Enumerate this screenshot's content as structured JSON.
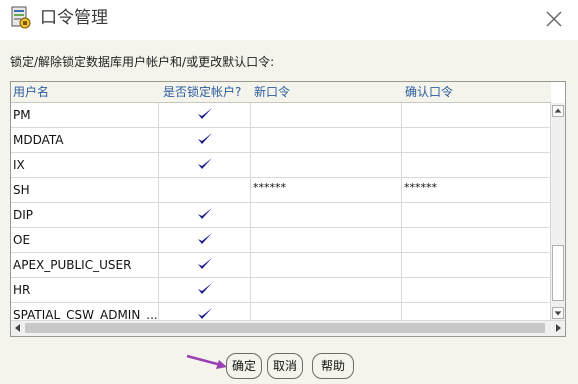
{
  "window": {
    "title": "口令管理"
  },
  "instruction": "锁定/解除锁定数据库用户帐户和/或更改默认口令:",
  "grid": {
    "headers": {
      "user": "用户名",
      "locked": "是否锁定帐户?",
      "new_password": "新口令",
      "confirm_password": "确认口令"
    },
    "rows": [
      {
        "user": "PM",
        "locked": true,
        "new_password": "",
        "confirm_password": ""
      },
      {
        "user": "MDDATA",
        "locked": true,
        "new_password": "",
        "confirm_password": ""
      },
      {
        "user": "IX",
        "locked": true,
        "new_password": "",
        "confirm_password": ""
      },
      {
        "user": "SH",
        "locked": false,
        "new_password": "******",
        "confirm_password": "******"
      },
      {
        "user": "DIP",
        "locked": true,
        "new_password": "",
        "confirm_password": ""
      },
      {
        "user": "OE",
        "locked": true,
        "new_password": "",
        "confirm_password": ""
      },
      {
        "user": "APEX_PUBLIC_USER",
        "locked": true,
        "new_password": "",
        "confirm_password": ""
      },
      {
        "user": "HR",
        "locked": true,
        "new_password": "",
        "confirm_password": ""
      },
      {
        "user": "SPATIAL_CSW_ADMIN_...",
        "locked": true,
        "new_password": "",
        "confirm_password": ""
      }
    ]
  },
  "buttons": {
    "ok": "确定",
    "cancel": "取消",
    "help": "帮助"
  },
  "colors": {
    "header_text": "#2a5d9e",
    "checkmark": "#1a1a8c",
    "pointer_arrow": "#9b3fb5"
  },
  "icons": {
    "app": "oracle-app-icon",
    "close": "close-icon",
    "check": "checkmark-icon",
    "pointer": "pointer-arrow-icon"
  }
}
